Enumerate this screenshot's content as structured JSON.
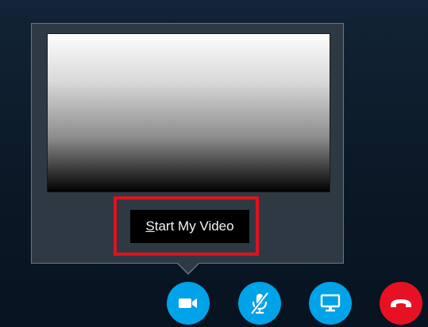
{
  "video_popup": {
    "start_video_label_accel": "S",
    "start_video_label_rest": "tart My Video",
    "highlight_color": "#e0121c"
  },
  "call_controls": {
    "accent_color": "#00a2e8",
    "end_call_color": "#e81123",
    "buttons": [
      {
        "icon": "video-camera-icon"
      },
      {
        "icon": "microphone-muted-icon"
      },
      {
        "icon": "present-screen-icon"
      },
      {
        "icon": "hang-up-phone-icon"
      }
    ]
  }
}
